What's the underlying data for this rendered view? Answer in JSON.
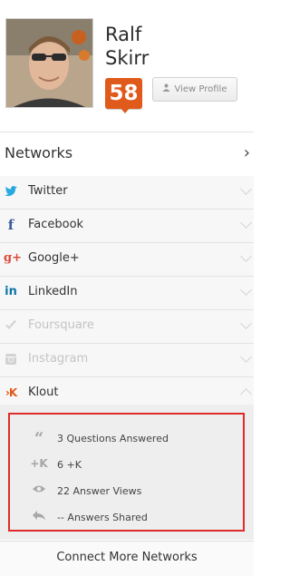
{
  "profile": {
    "first_name": "Ralf",
    "last_name": "Skirr",
    "score": "58",
    "view_profile_label": "View Profile",
    "brand_color": "#e05a1b"
  },
  "networks_header": {
    "label": "Networks",
    "chevron": "chevron-right-icon"
  },
  "networks": [
    {
      "label": "Twitter",
      "icon": "twitter-icon",
      "color": "#2aa9e0",
      "state": "enabled"
    },
    {
      "label": "Facebook",
      "icon": "facebook-icon",
      "color": "#3b5998",
      "state": "enabled"
    },
    {
      "label": "Google+",
      "icon": "google-plus-icon",
      "color": "#dd4b39",
      "state": "enabled"
    },
    {
      "label": "LinkedIn",
      "icon": "linkedin-icon",
      "color": "#0e76a8",
      "state": "enabled"
    },
    {
      "label": "Foursquare",
      "icon": "foursquare-icon",
      "color": "#cfcfcf",
      "state": "disabled"
    },
    {
      "label": "Instagram",
      "icon": "instagram-icon",
      "color": "#cfcfcf",
      "state": "disabled"
    },
    {
      "label": "Klout",
      "icon": "klout-icon",
      "color": "#e05a1b",
      "state": "expanded"
    }
  ],
  "klout_stats": [
    {
      "icon": "quote-icon",
      "text": "3 Questions Answered"
    },
    {
      "icon": "plus-k-icon",
      "text": "6 +K"
    },
    {
      "icon": "eye-icon",
      "text": "22 Answer Views"
    },
    {
      "icon": "share-icon",
      "text": "-- Answers Shared"
    }
  ],
  "footer": {
    "connect_label": "Connect More Networks"
  },
  "highlight_color": "#e02b2b"
}
